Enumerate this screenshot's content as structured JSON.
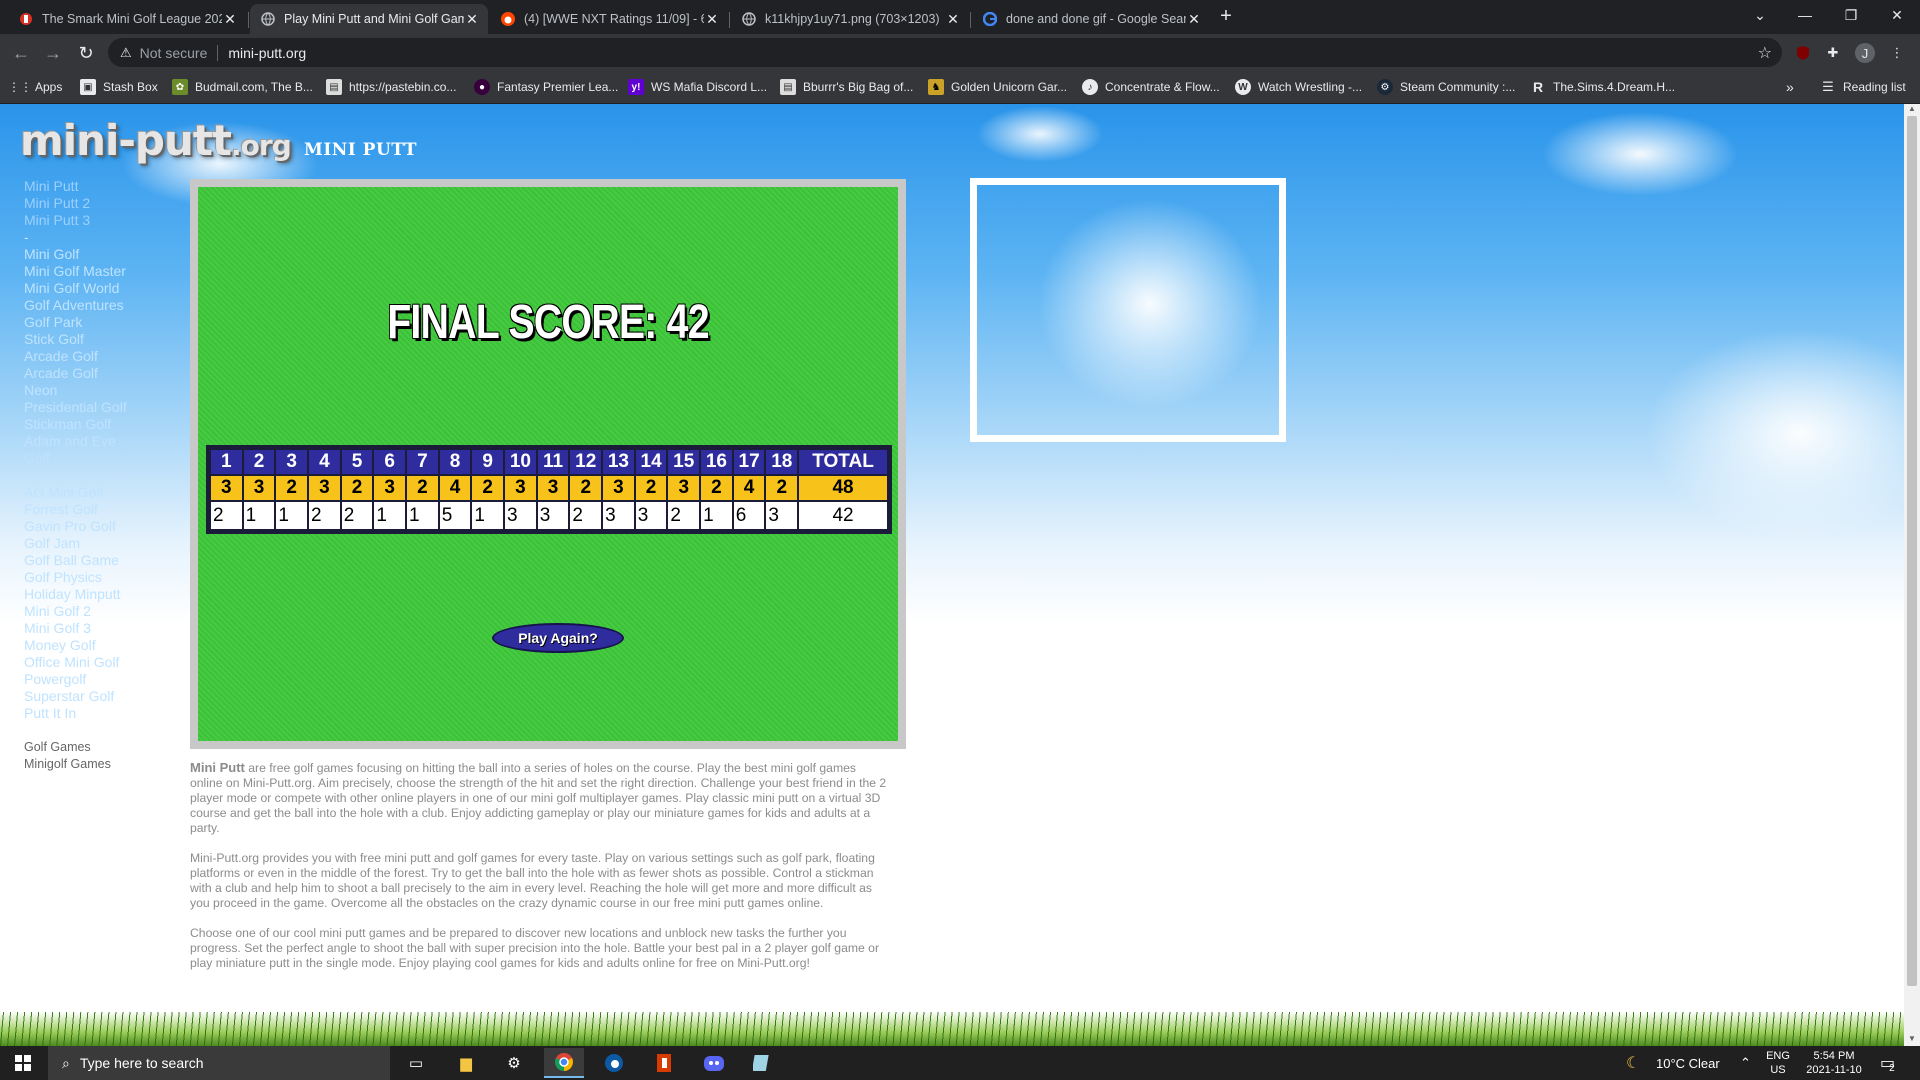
{
  "browser": {
    "tabs": [
      {
        "title": "The Smark Mini Golf League 202",
        "icon": "red-badge-icon",
        "active": false
      },
      {
        "title": "Play Mini Putt and Mini Golf Gam",
        "icon": "globe-icon",
        "active": true
      },
      {
        "title": "(4) [WWE NXT Ratings 11/09] - 6",
        "icon": "reddit-icon",
        "active": false
      },
      {
        "title": "k11khjpy1uy71.png (703×1203)",
        "icon": "globe-icon",
        "active": false
      },
      {
        "title": "done and done gif - Google Sear",
        "icon": "google-icon",
        "active": false
      }
    ],
    "address": {
      "security": "Not secure",
      "url": "mini-putt.org"
    },
    "bookmarks": [
      {
        "label": "Apps",
        "icon": "apps-grid-icon"
      },
      {
        "label": "Stash Box",
        "icon": "box-icon"
      },
      {
        "label": "Budmail.com, The B...",
        "icon": "leaf-icon"
      },
      {
        "label": "https://pastebin.co...",
        "icon": "page-icon"
      },
      {
        "label": "Fantasy Premier Lea...",
        "icon": "purple-shield-icon"
      },
      {
        "label": "WS Mafia Discord L...",
        "icon": "yahoo-icon"
      },
      {
        "label": "Bburrr's Big Bag of...",
        "icon": "page-icon"
      },
      {
        "label": "Golden Unicorn Gar...",
        "icon": "unicorn-icon"
      },
      {
        "label": "Concentrate & Flow...",
        "icon": "music-icon"
      },
      {
        "label": "Watch Wrestling -...",
        "icon": "wordpress-icon"
      },
      {
        "label": "Steam Community :...",
        "icon": "steam-icon"
      },
      {
        "label": "The.Sims.4.Dream.H...",
        "icon": "r-icon"
      }
    ],
    "reading_list": "Reading list",
    "profile_initial": "J"
  },
  "site": {
    "logo": "mini-putt",
    "logo_tld": ".org",
    "title": "MINI PUTT",
    "nav_top": [
      "Mini Putt",
      "Mini Putt 2",
      "Mini Putt 3"
    ],
    "nav_sep1": "-",
    "nav_mid": [
      "Mini Golf",
      "Mini Golf Master",
      "Mini Golf World",
      "Golf Adventures",
      "Golf Park",
      "Stick Golf",
      "Arcade Golf",
      "Arcade Golf",
      "Neon",
      "Presidential Golf",
      "Stickman Golf",
      "Adam and Eve",
      "Golf"
    ],
    "nav_sep2": "-",
    "nav_bottom": [
      "AG Mini Golf",
      "Forrest Golf",
      "Gavin Pro Golf",
      "Golf Jam",
      "Golf Ball Game",
      "Golf Physics",
      "Holiday Minputt",
      "Mini Golf 2",
      "Mini Golf 3",
      "Money Golf",
      "Office Mini Golf",
      "Powergolf",
      "Superstar Golf",
      "Putt It In"
    ],
    "nav_footer": [
      "Golf Games",
      "Minigolf Games"
    ]
  },
  "game": {
    "final_score_label": "FINAL SCORE: 42",
    "holes": [
      "1",
      "2",
      "3",
      "4",
      "5",
      "6",
      "7",
      "8",
      "9",
      "10",
      "11",
      "12",
      "13",
      "14",
      "15",
      "16",
      "17",
      "18"
    ],
    "total_label": "TOTAL",
    "par": [
      "3",
      "3",
      "2",
      "3",
      "2",
      "3",
      "2",
      "4",
      "2",
      "3",
      "3",
      "2",
      "3",
      "2",
      "3",
      "2",
      "4",
      "2"
    ],
    "par_total": "48",
    "scores": [
      "2",
      "1",
      "1",
      "2",
      "2",
      "1",
      "1",
      "5",
      "1",
      "3",
      "3",
      "2",
      "3",
      "3",
      "2",
      "1",
      "6",
      "3"
    ],
    "score_total": "42",
    "play_again": "Play Again?"
  },
  "description": {
    "p1_lead": "Mini Putt",
    "p1": " are free golf games focusing on hitting the ball into a series of holes on the course. Play the best mini golf games online on Mini-Putt.org. Aim precisely, choose the strength of the hit and set the right direction. Challenge your best friend in the 2 player mode or compete with other online players in one of our mini golf multiplayer games. Play classic mini putt on a virtual 3D course and get the ball into the hole with a club. Enjoy addicting gameplay or play our miniature games for kids and adults at a party.",
    "p2": "Mini-Putt.org provides you with free mini putt and golf games for every taste. Play on various settings such as golf park, floating platforms or even in the middle of the forest. Try to get the ball into the hole with as fewer shots as possible. Control a stickman with a club and help him to shoot a ball precisely to the aim in every level. Reaching the hole will get more and more difficult as you proceed in the game. Overcome all the obstacles on the crazy dynamic course in our free mini putt games online.",
    "p3": "Choose one of our cool mini putt games and be prepared to discover new locations and unblock new tasks the further you progress. Set the perfect angle to shoot the ball with super precision into the hole. Battle your best pal in a 2 player golf game or play miniature putt in the single mode. Enjoy playing cool games for kids and adults online for free on Mini-Putt.org!"
  },
  "taskbar": {
    "search_placeholder": "Type here to search",
    "weather": "10°C  Clear",
    "lang_top": "ENG",
    "lang_bottom": "US",
    "time": "5:54 PM",
    "date": "2021-11-10",
    "notification_count": "2"
  },
  "colors": {
    "accent_blue": "#2f2c9e",
    "par_yellow": "#f7c21a",
    "course_green": "#3ec93b"
  }
}
